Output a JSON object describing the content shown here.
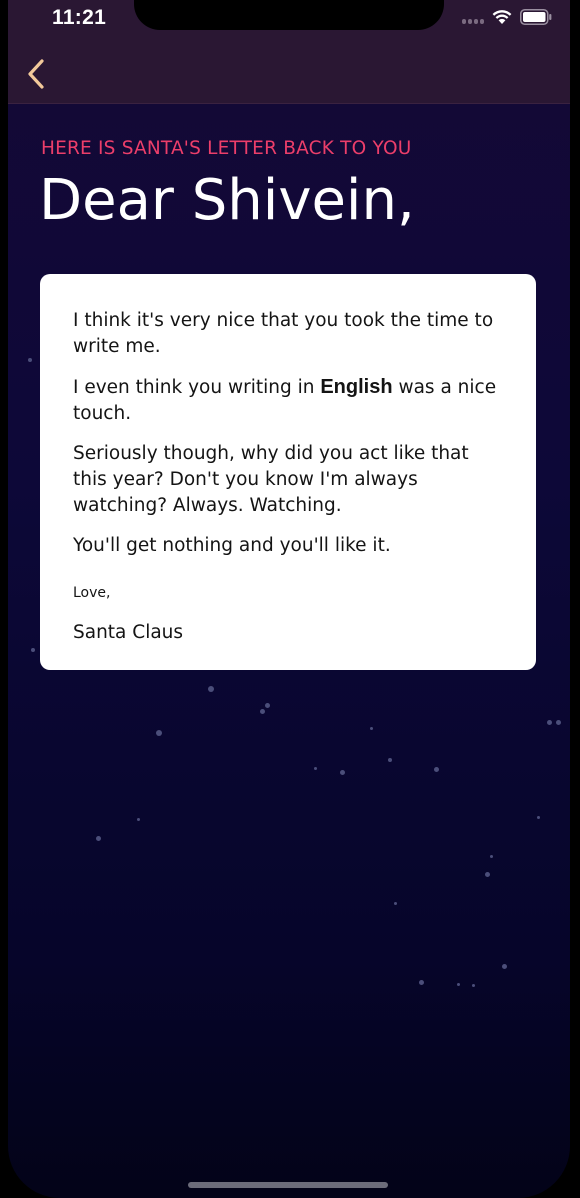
{
  "status_bar": {
    "time": "11:21",
    "icons": [
      "cellular-signal-icon",
      "wifi-icon",
      "battery-icon"
    ]
  },
  "nav": {
    "back_icon": "chevron-left-icon",
    "back_color": "#f2c99a"
  },
  "header": {
    "subtitle": "HERE IS SANTA'S LETTER BACK TO YOU",
    "greeting": "Dear Shivein,"
  },
  "letter": {
    "paragraphs": [
      {
        "text": "I think it's very nice that you took the time to write me."
      },
      {
        "before": "I even think you writing in ",
        "bold": "English",
        "after": " was a nice touch."
      },
      {
        "text": "Seriously though, why did you act like that this year? Don't you know I'm always watching? Always. Watching."
      },
      {
        "text": "You'll get nothing and you'll like it."
      }
    ],
    "sign_off": "Love,",
    "signature": "Santa Claus"
  },
  "colors": {
    "accent": "#ec3e6a",
    "topbar": "#2a1733",
    "background": "#0d0838",
    "card": "#ffffff"
  }
}
